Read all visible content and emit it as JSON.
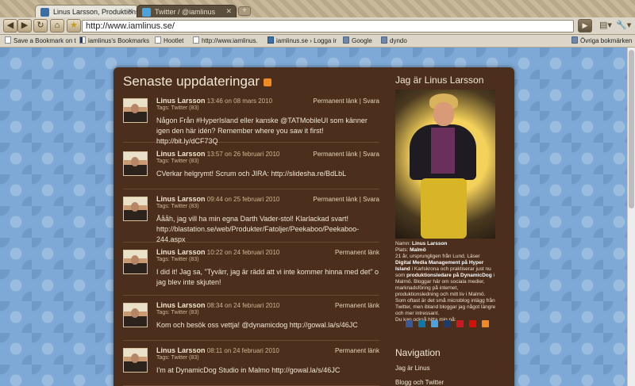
{
  "browser": {
    "tabs": [
      {
        "title": "Linus Larsson, Produktionsle",
        "active": true
      },
      {
        "title": "Twitter / @iamlinus",
        "active": false
      }
    ],
    "url": "http://www.iamlinus.se/",
    "bookmarks": [
      "Save a Bookmark on t",
      "iamlinus's Bookmarks",
      "Hootlet",
      "http://www.iamlinus.",
      "iamlinus.se › Logga ir",
      "Google",
      "dyndo"
    ],
    "other_bookmarks": "Övriga bokmärken"
  },
  "main": {
    "title": "Senaste uppdateringar",
    "updates": [
      {
        "name": "Linus Larsson",
        "time": "13:46 on 08 mars 2010",
        "permalink": "Permanent länk",
        "sep": "|",
        "reply": "Svara",
        "tags": "Tags: Twitter (83)",
        "text": "Någon Från #HyperIsland eller kanske @TATMobileUI som känner igen den här idén? Remember where you saw it first! http://bit.ly/dCF73Q"
      },
      {
        "name": "Linus Larsson",
        "time": "13:57 on 26 februari 2010",
        "permalink": "Permanent länk",
        "sep": "|",
        "reply": "Svara",
        "tags": "Tags: Twitter (83)",
        "text": "CVerkar helgrymt! Scrum och JIRA: http://slidesha.re/BdLbL"
      },
      {
        "name": "Linus Larsson",
        "time": "09:44 on 25 februari 2010",
        "permalink": "Permanent länk",
        "sep": "|",
        "reply": "Svara",
        "tags": "Tags: Twitter (83)",
        "text": "Åååh, jag vill ha min egna Darth Vader-stol! Klarlackad svart! http://blastation.se/web/Produkter/Fatoljer/Peekaboo/Peekaboo-244.aspx"
      },
      {
        "name": "Linus Larsson",
        "time": "10:22 on 24 februari 2010",
        "permalink": "Permanent länk",
        "tags": "Tags: Twitter (83)",
        "text": "I did it! Jag sa, \"Tyvärr, jag är rädd att vi inte kommer hinna med det\" o jag blev inte skjuten!"
      },
      {
        "name": "Linus Larsson",
        "time": "08:34 on 24 februari 2010",
        "permalink": "Permanent länk",
        "tags": "Tags: Twitter (83)",
        "text": "Kom och besök oss vettja! @dynamicdog http://gowal.la/s/46JC"
      },
      {
        "name": "Linus Larsson",
        "time": "08:11 on 24 februari 2010",
        "permalink": "Permanent länk",
        "tags": "Tags: Twitter (83)",
        "text": "I'm at DynamicDog Studio in Malmo http://gowal.la/s/46JC"
      }
    ]
  },
  "sidebar": {
    "title": "Jag är Linus Larsson",
    "bio": {
      "name_label": "Namn:",
      "name": "Linus Larsson",
      "place_label": "Plats:",
      "place": "Malmö",
      "text1": "21 år, ursprungligen från Lund. Läser",
      "study": "Digital Media Management på Hyper Island",
      "text2": "i Karlskrona och praktiserar just nu som",
      "job": "produktionsledare på DynamicDog",
      "text3": "i Malmö. Bloggar här om sociala medier, marknadsföring på internet, produktionsledning och mitt liv i Malmö. Som oftast är det små microblog inlägg från Twitter, men ibland bloggar jag något längre och mer intressant.",
      "find_me": "Du kan också hitta mig på:"
    },
    "social": [
      {
        "name": "facebook-icon",
        "color": "#3b5998"
      },
      {
        "name": "linkedin-icon",
        "color": "#0e76a8"
      },
      {
        "name": "twitter-icon",
        "color": "#4aa3df"
      },
      {
        "name": "delicious-icon",
        "color": "#1e3c6e"
      },
      {
        "name": "youtube-icon",
        "color": "#cc181e"
      },
      {
        "name": "lastfm-icon",
        "color": "#d51007"
      },
      {
        "name": "rss-icon",
        "color": "#f08a24"
      }
    ],
    "nav_title": "Navigation",
    "nav": [
      "Jag är Linus",
      "Blogg och Twitter"
    ]
  }
}
